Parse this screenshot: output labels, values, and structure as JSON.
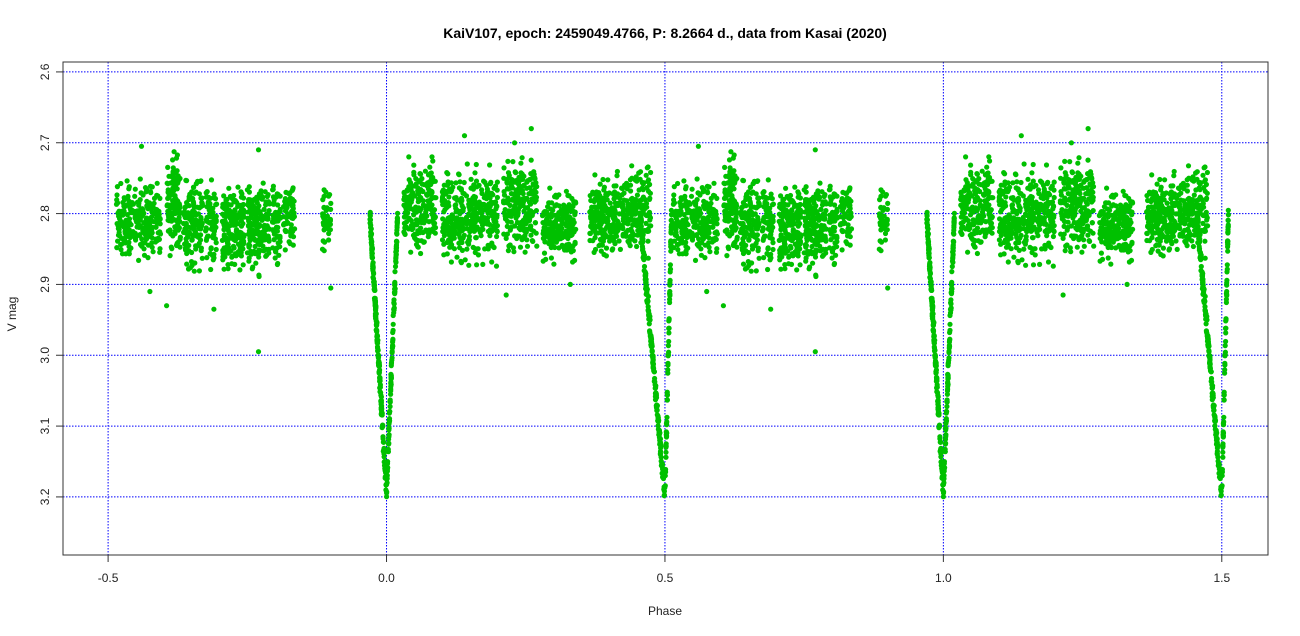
{
  "chart_data": {
    "type": "scatter",
    "title": "KaiV107, epoch: 2459049.4766, P: 8.2664 d., data from Kasai (2020)",
    "xlabel": "Phase",
    "ylabel": "V mag",
    "xlim": [
      -0.581,
      1.583
    ],
    "ylim": [
      3.282,
      2.586
    ],
    "y_inverted": true,
    "xticks": [
      -0.5,
      0.0,
      0.5,
      1.0,
      1.5
    ],
    "xtick_labels": [
      "-0.5",
      "0.0",
      "0.5",
      "1.0",
      "1.5"
    ],
    "yticks": [
      2.6,
      2.7,
      2.8,
      2.9,
      3.0,
      3.1,
      3.2
    ],
    "ytick_labels": [
      "2.6",
      "2.7",
      "2.8",
      "2.9",
      "3.0",
      "3.1",
      "3.2"
    ],
    "grid": true,
    "point_color": "#00c000",
    "grid_color": "#0000ff",
    "phase_repeat": "data in phase -0.5..0.5 repeated at +1.0",
    "out_of_eclipse_clusters": {
      "columns": [
        "phase_start",
        "phase_end",
        "mag_min",
        "mag_max",
        "n_points"
      ],
      "rows": [
        [
          -0.485,
          -0.405,
          2.74,
          2.88,
          260
        ],
        [
          -0.395,
          -0.37,
          2.7,
          2.88,
          120
        ],
        [
          -0.365,
          -0.33,
          2.73,
          2.9,
          130
        ],
        [
          -0.325,
          -0.305,
          2.73,
          2.89,
          70
        ],
        [
          -0.295,
          -0.255,
          2.73,
          2.9,
          180
        ],
        [
          -0.25,
          -0.21,
          2.73,
          2.9,
          180
        ],
        [
          -0.205,
          -0.19,
          2.74,
          2.89,
          60
        ],
        [
          -0.185,
          -0.165,
          2.74,
          2.87,
          60
        ],
        [
          -0.115,
          -0.1,
          2.73,
          2.9,
          40
        ],
        [
          0.03,
          0.09,
          2.7,
          2.88,
          200
        ],
        [
          0.1,
          0.2,
          2.72,
          2.89,
          350
        ],
        [
          0.21,
          0.27,
          2.7,
          2.88,
          220
        ],
        [
          0.28,
          0.34,
          2.75,
          2.88,
          200
        ],
        [
          0.365,
          0.44,
          2.73,
          2.88,
          260
        ],
        [
          0.44,
          0.475,
          2.7,
          2.88,
          100
        ]
      ]
    },
    "eclipses": {
      "columns": [
        "center_phase",
        "ingress_halfwidth",
        "egress_halfwidth",
        "base_mag",
        "min_mag",
        "n_points"
      ],
      "rows": [
        [
          0.0,
          0.03,
          0.02,
          2.8,
          3.195,
          320
        ],
        [
          0.5,
          0.045,
          0.012,
          2.8,
          3.2,
          300
        ]
      ]
    },
    "outliers": [
      [
        -0.395,
        2.93
      ],
      [
        -0.31,
        2.935
      ],
      [
        -0.23,
        2.995
      ],
      [
        -0.425,
        2.91
      ],
      [
        -0.23,
        2.71
      ],
      [
        -0.44,
        2.705
      ],
      [
        0.04,
        2.72
      ],
      [
        0.14,
        2.69
      ],
      [
        0.26,
        2.68
      ],
      [
        0.23,
        2.7
      ],
      [
        0.215,
        2.915
      ],
      [
        0.145,
        2.73
      ],
      [
        -0.1,
        2.905
      ],
      [
        0.33,
        2.9
      ]
    ]
  }
}
